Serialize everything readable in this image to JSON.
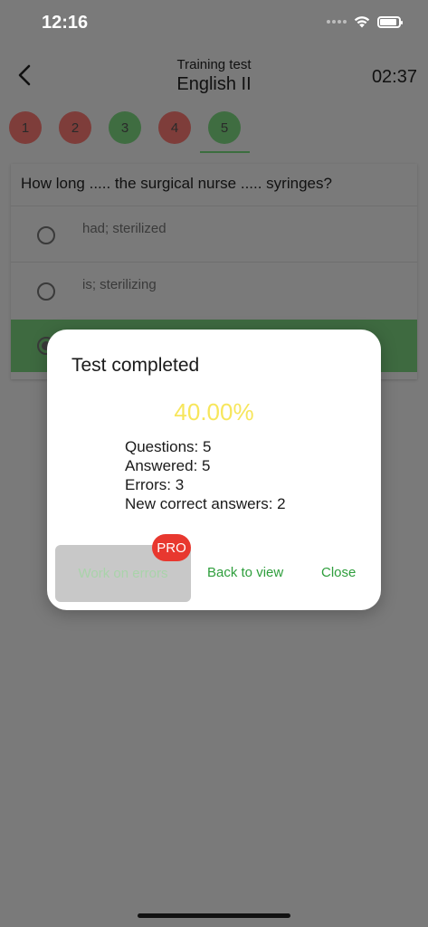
{
  "status_bar": {
    "time": "12:16"
  },
  "header": {
    "subtitle": "Training test",
    "title": "English II",
    "timer": "02:37"
  },
  "question_nav": [
    {
      "label": "1",
      "state": "wrong"
    },
    {
      "label": "2",
      "state": "wrong"
    },
    {
      "label": "3",
      "state": "right"
    },
    {
      "label": "4",
      "state": "wrong"
    },
    {
      "label": "5",
      "state": "right",
      "current": true
    }
  ],
  "question": {
    "text": "How long ..... the surgical nurse ..... syringes?",
    "options": [
      {
        "text": "had; sterilized",
        "selected": false
      },
      {
        "text": "is; sterilizing",
        "selected": false
      },
      {
        "text": "",
        "selected": true
      }
    ]
  },
  "dialog": {
    "title": "Test completed",
    "percent": "40.00%",
    "stats": {
      "questions": "Questions: 5",
      "answered": "Answered: 5",
      "errors": "Errors: 3",
      "new_correct": "New correct answers: 2"
    },
    "buttons": {
      "work_on_errors": "Work on errors",
      "pro_badge": "PRO",
      "back_to_view": "Back to view",
      "close": "Close"
    }
  },
  "colors": {
    "accent_green": "#2e9e3c",
    "percent_yellow": "#f7e65c",
    "pro_red": "#e8382f",
    "wrong": "#c84843",
    "right": "#4a8c4d"
  }
}
